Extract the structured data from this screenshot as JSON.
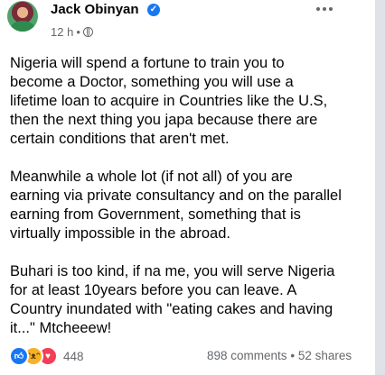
{
  "post": {
    "author": "Jack Obinyan",
    "time": "12 h",
    "separator": "•",
    "paragraphs": [
      "Nigeria will spend a fortune to train you to\nbecome a Doctor, something you will use a\nlifetime loan to acquire in Countries like the U.S,\nthen the next thing you japa because there are\ncertain conditions that aren't met.",
      "Meanwhile a whole lot (if not all) of you are\nearning via private consultancy and on the parallel\nearning from Government, something that is\nvirtually impossible in the abroad.",
      "Buhari is too kind, if na me, you will serve Nigeria\nfor at least 10years before you can leave. A\nCountry inundated with \"eating cakes and having\nit...\" Mtcheeew!"
    ]
  },
  "reactions": {
    "icons": [
      "like-icon",
      "haha-icon",
      "love-icon"
    ],
    "count": "448"
  },
  "stats": {
    "comments": "898 comments",
    "dot": "•",
    "shares": "52 shares"
  },
  "colors": {
    "verified": "#1877f2",
    "meta": "#65676b"
  }
}
